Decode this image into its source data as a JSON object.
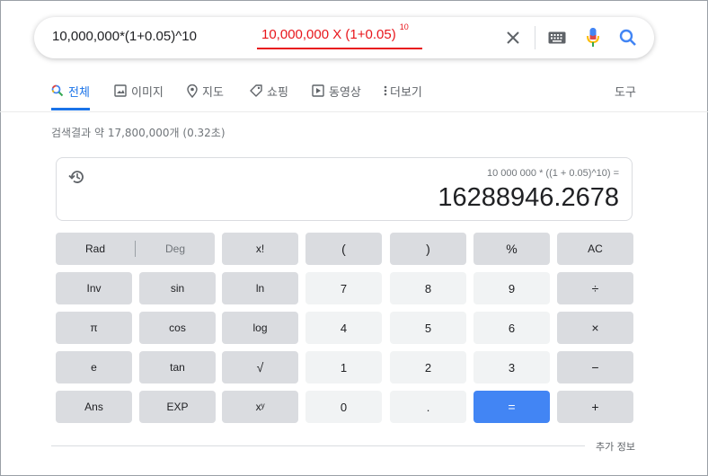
{
  "search": {
    "query": "10,000,000*(1+0.05)^10",
    "annotation": "10,000,000 X (1+0.05)",
    "annotation_exp": "10"
  },
  "tabs": [
    {
      "label": "전체",
      "icon": "search-icon",
      "active": true
    },
    {
      "label": "이미지",
      "icon": "image-icon",
      "active": false
    },
    {
      "label": "지도",
      "icon": "map-pin-icon",
      "active": false
    },
    {
      "label": "쇼핑",
      "icon": "tag-icon",
      "active": false
    },
    {
      "label": "동영상",
      "icon": "play-icon",
      "active": false
    },
    {
      "label": "더보기",
      "icon": "more-vert-icon",
      "active": false
    }
  ],
  "tools_label": "도구",
  "result_stats": "검색결과 약 17,800,000개 (0.32초)",
  "calculator": {
    "expression": "10 000 000 * ((1 + 0.05)^10) =",
    "result": "16288946.2678",
    "rad_label": "Rad",
    "deg_label": "Deg",
    "keys": {
      "fact": "x!",
      "lparen": "(",
      "rparen": ")",
      "percent": "%",
      "ac": "AC",
      "inv": "Inv",
      "sin": "sin",
      "ln": "ln",
      "k7": "7",
      "k8": "8",
      "k9": "9",
      "divide": "÷",
      "pi": "π",
      "cos": "cos",
      "log": "log",
      "k4": "4",
      "k5": "5",
      "k6": "6",
      "multiply": "×",
      "e": "e",
      "tan": "tan",
      "sqrt": "√",
      "k1": "1",
      "k2": "2",
      "k3": "3",
      "minus": "−",
      "ans": "Ans",
      "exp": "EXP",
      "pow": "xʸ",
      "k0": "0",
      "dot": ".",
      "equals": "=",
      "plus": "+"
    }
  },
  "more_info": "추가 정보",
  "colors": {
    "accent": "#1a73e8",
    "equals_key": "#4285f4",
    "annotation": "#e8151b"
  }
}
